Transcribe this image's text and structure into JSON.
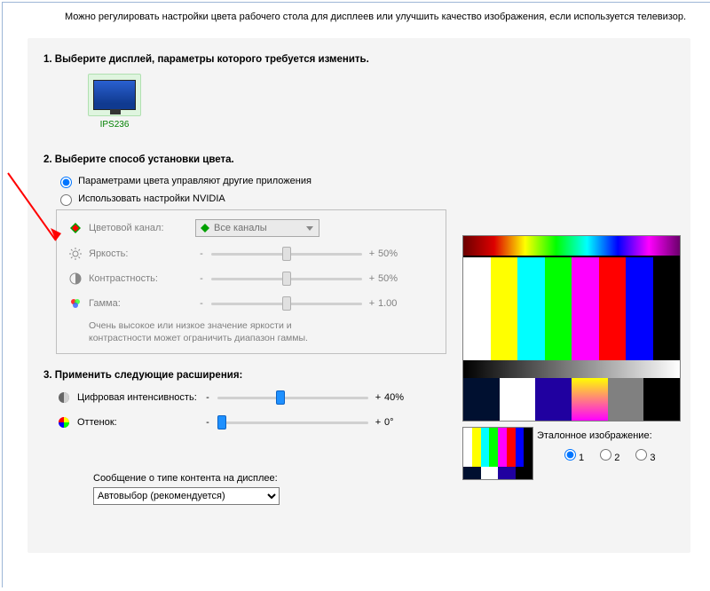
{
  "description": "Можно регулировать настройки цвета рабочего стола для дисплеев или улучшить качество изображения, если используется телевизор.",
  "step1": {
    "heading": "1. Выберите дисплей, параметры которого требуется изменить.",
    "display_name": "IPS236"
  },
  "step2": {
    "heading": "2. Выберите способ установки цвета.",
    "radio_other_apps": "Параметрами цвета управляют другие приложения",
    "radio_nvidia": "Использовать настройки NVIDIA",
    "channel_label": "Цветовой канал:",
    "channel_value": "Все каналы",
    "brightness_label": "Яркость:",
    "brightness_value": "50%",
    "contrast_label": "Контрастность:",
    "contrast_value": "50%",
    "gamma_label": "Гамма:",
    "gamma_value": "1.00",
    "note_line1": "Очень высокое или низкое значение яркости и",
    "note_line2": "контрастности может ограничить диапазон гаммы.",
    "minus": "-",
    "plus": "+"
  },
  "step3": {
    "heading": "3. Применить следующие расширения:",
    "vibrance_label": "Цифровая интенсивность:",
    "vibrance_value": "40%",
    "hue_label": "Оттенок:",
    "hue_value": "0°",
    "minus": "-",
    "plus": "+"
  },
  "content_type": {
    "label": "Сообщение о типе контента на дисплее:",
    "selected": "Автовыбор (рекомендуется)"
  },
  "reference": {
    "label": "Эталонное изображение:",
    "options": [
      "1",
      "2",
      "3"
    ]
  }
}
